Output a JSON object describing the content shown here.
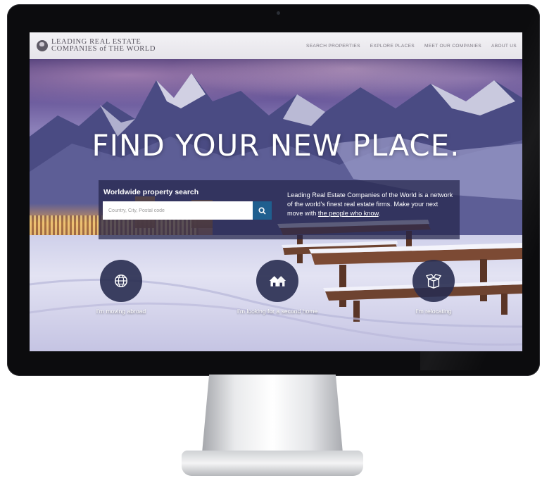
{
  "nav": {
    "logo_line1": "LEADING REAL ESTATE",
    "logo_line2": "COMPANIES of THE WORLD",
    "links": [
      {
        "label": "SEARCH PROPERTIES"
      },
      {
        "label": "EXPLORE PLACES"
      },
      {
        "label": "MEET OUR COMPANIES"
      },
      {
        "label": "ABOUT US"
      }
    ]
  },
  "hero": {
    "headline": "FIND YOUR NEW PLACE."
  },
  "search": {
    "title": "Worldwide property search",
    "placeholder": "Country, City, Postal code",
    "description_text": "Leading Real Estate Companies of the World is a network of the world's finest real estate firms. Make your next move with ",
    "description_link": "the people who know",
    "description_end": "."
  },
  "options": [
    {
      "label": "I'm moving abroad",
      "icon": "globe-icon"
    },
    {
      "label": "I'm looking for a second home",
      "icon": "house-icon"
    },
    {
      "label": "I'm relocating",
      "icon": "box-icon"
    }
  ],
  "colors": {
    "accent": "#1f5f8f",
    "panel": "#22244a",
    "nav_bg": "#f3f2f5"
  }
}
